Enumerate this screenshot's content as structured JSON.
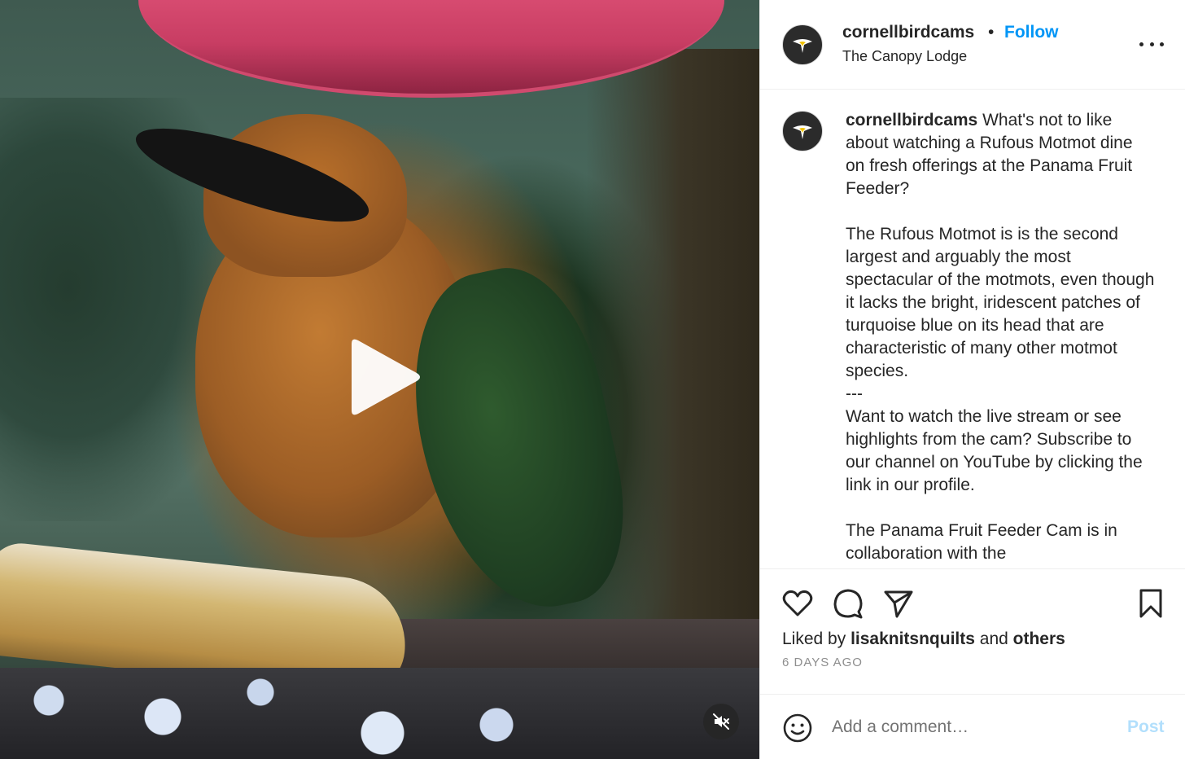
{
  "media": {
    "play_icon": "play-icon",
    "mute_icon": "muted-speaker-icon"
  },
  "header": {
    "username": "cornellbirdcams",
    "separator": "•",
    "follow_label": "Follow",
    "location": "The Canopy Lodge",
    "more_icon": "more-options-icon"
  },
  "caption": {
    "username": "cornellbirdcams",
    "text": " What's not to like about watching a Rufous Motmot dine on fresh offerings at the Panama Fruit Feeder?\n\nThe Rufous Motmot is is the second largest and arguably the most spectacular of the motmots, even though it lacks the bright, iridescent patches of turquoise blue on its head that are characteristic of many other motmot species.\n---\nWant to watch the live stream or see highlights from the cam? Subscribe to our channel on YouTube by clicking the link in our profile.\n\nThe Panama Fruit Feeder Cam is in collaboration with the"
  },
  "actions": {
    "like_icon": "heart-icon",
    "comment_icon": "comment-icon",
    "share_icon": "paper-plane-icon",
    "save_icon": "bookmark-icon",
    "liked_prefix": "Liked by ",
    "liked_user": "lisaknitsnquilts",
    "liked_and": " and ",
    "liked_others": "others",
    "timestamp": "6 DAYS AGO"
  },
  "comment": {
    "emoji_icon": "smiley-icon",
    "placeholder": "Add a comment…",
    "post_label": "Post"
  },
  "colors": {
    "link_blue": "#0095f6",
    "post_disabled": "#b2dffc",
    "text": "#262626",
    "muted": "#8e8e8e"
  }
}
